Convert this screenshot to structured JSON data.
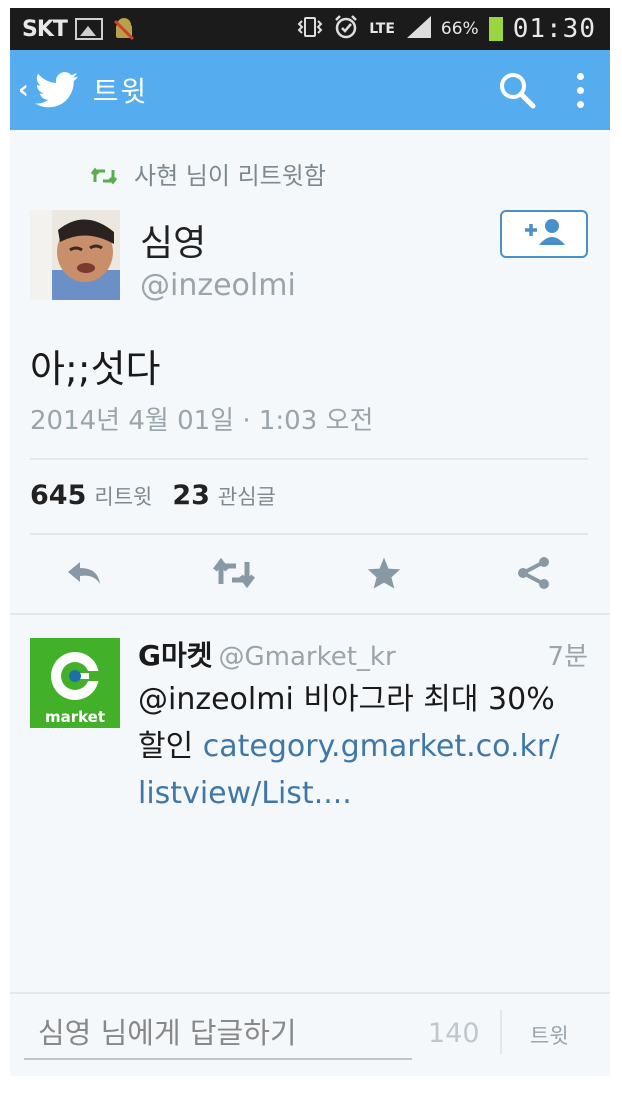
{
  "status_bar": {
    "carrier": "SKT",
    "lte": "LTE",
    "battery_percent": "66%",
    "clock": "01:30",
    "battery_color": "#9ad640"
  },
  "app_bar": {
    "back_glyph": "‹",
    "title": "트윗",
    "background": "#55acee"
  },
  "tweet": {
    "retweeted_by": "사현 님이 리트윗함",
    "author_name": "심영",
    "author_handle": "@inzeolmi",
    "text": "아;;섯다",
    "date": "2014년 4월 01일 · 1:03 오전",
    "retweet_count": "645",
    "retweet_label": "리트윗",
    "favorite_count": "23",
    "favorite_label": "관심글",
    "actions": [
      "reply-icon",
      "retweet-icon",
      "favorite-star-icon",
      "share-icon"
    ]
  },
  "reply": {
    "avatar_text": "market",
    "author_name": "G마켓",
    "author_handle": "@Gmarket_kr",
    "time": "7분",
    "mention": "@inzeolmi",
    "text_line1": " 비아그라 최대 30%",
    "text_line2": "할인 ",
    "link_line1": "category.gmarket.co.kr/",
    "link_line2": "listview/List....",
    "brand_color": "#43b02a"
  },
  "compose": {
    "placeholder": "심영 님에게 답글하기",
    "char_count": "140",
    "submit_label": "트윗"
  }
}
